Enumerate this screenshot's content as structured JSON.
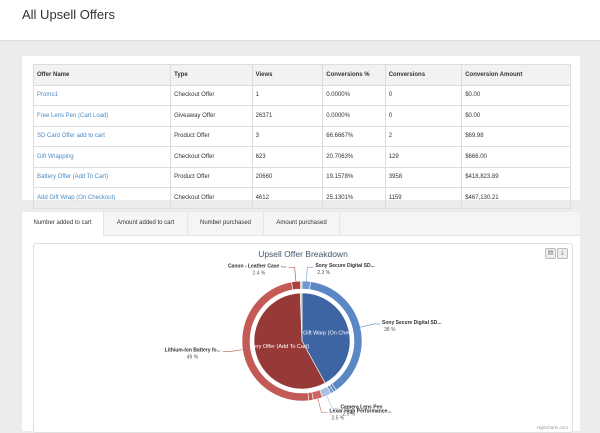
{
  "page": {
    "title": "All Upsell Offers"
  },
  "table": {
    "headers": [
      "Offer Name",
      "Type",
      "Views",
      "Conversions %",
      "Conversions",
      "Conversion Amount"
    ],
    "rows": [
      [
        "Promo1",
        "Checkout Offer",
        "1",
        "0.0000%",
        "0",
        "$0.00"
      ],
      [
        "Free Lens Pen (Cart Load)",
        "Giveaway Offer",
        "26371",
        "0.0000%",
        "0",
        "$0.00"
      ],
      [
        "SD Card Offer add to cart",
        "Product Offer",
        "3",
        "66.6667%",
        "2",
        "$69.98"
      ],
      [
        "Gift Wrapping",
        "Checkout Offer",
        "623",
        "20.7063%",
        "129",
        "$666.00"
      ],
      [
        "Battery Offer (Add To Cart)",
        "Product Offer",
        "20660",
        "19.1578%",
        "3958",
        "$418,823.89"
      ],
      [
        "Add Gift Wrap (On Checkout)",
        "Checkout Offer",
        "4612",
        "25.1301%",
        "1159",
        "$467,130.21"
      ]
    ]
  },
  "tabs": [
    "Number added to cart",
    "Amount added to cart",
    "Number purchased",
    "Amount purchased"
  ],
  "active_tab": 0,
  "chart_data": {
    "type": "pie",
    "title": "Upsell Offer Breakdown",
    "credit": "Highcharts.com",
    "inner": [
      {
        "name": "Add Gift Warp (On Checkout)",
        "value": 42,
        "color": "#3d64a3"
      },
      {
        "name": "Battery Offer (Add To Cart)",
        "value": 57.4,
        "color": "#973a37"
      },
      {
        "name": "",
        "value": 0.6,
        "color": "#d9c26a"
      }
    ],
    "outer": [
      {
        "name": "Sony Secure Digital SD...",
        "value": 2.3,
        "label": "2.3 %",
        "color": "#6f98cf"
      },
      {
        "name": "Sony Secure Digital SD...",
        "value": 38,
        "label": "38 %",
        "color": "#5b87c4"
      },
      {
        "name": "",
        "value": 0.8,
        "color": "#5b87c4"
      },
      {
        "name": "",
        "value": 0.9,
        "color": "#6f98cf"
      },
      {
        "name": "Camera Lens Pen",
        "value": 2.5,
        "label": "2.5 %",
        "color": "#a9c0e0"
      },
      {
        "name": "Lexar High Performance...",
        "value": 2.5,
        "label": "2.5 %",
        "color": "#cf6460"
      },
      {
        "name": "",
        "value": 1.2,
        "color": "#c45a56"
      },
      {
        "name": "Lithium-Ion Battery fo...",
        "value": 49,
        "label": "49 %",
        "color": "#c45a56"
      },
      {
        "name": "Canon - Leather Case -...",
        "value": 2.4,
        "label": "2.4 %",
        "color": "#a8423e"
      },
      {
        "name": "",
        "value": 0.4,
        "color": "#e8d27a"
      }
    ]
  }
}
